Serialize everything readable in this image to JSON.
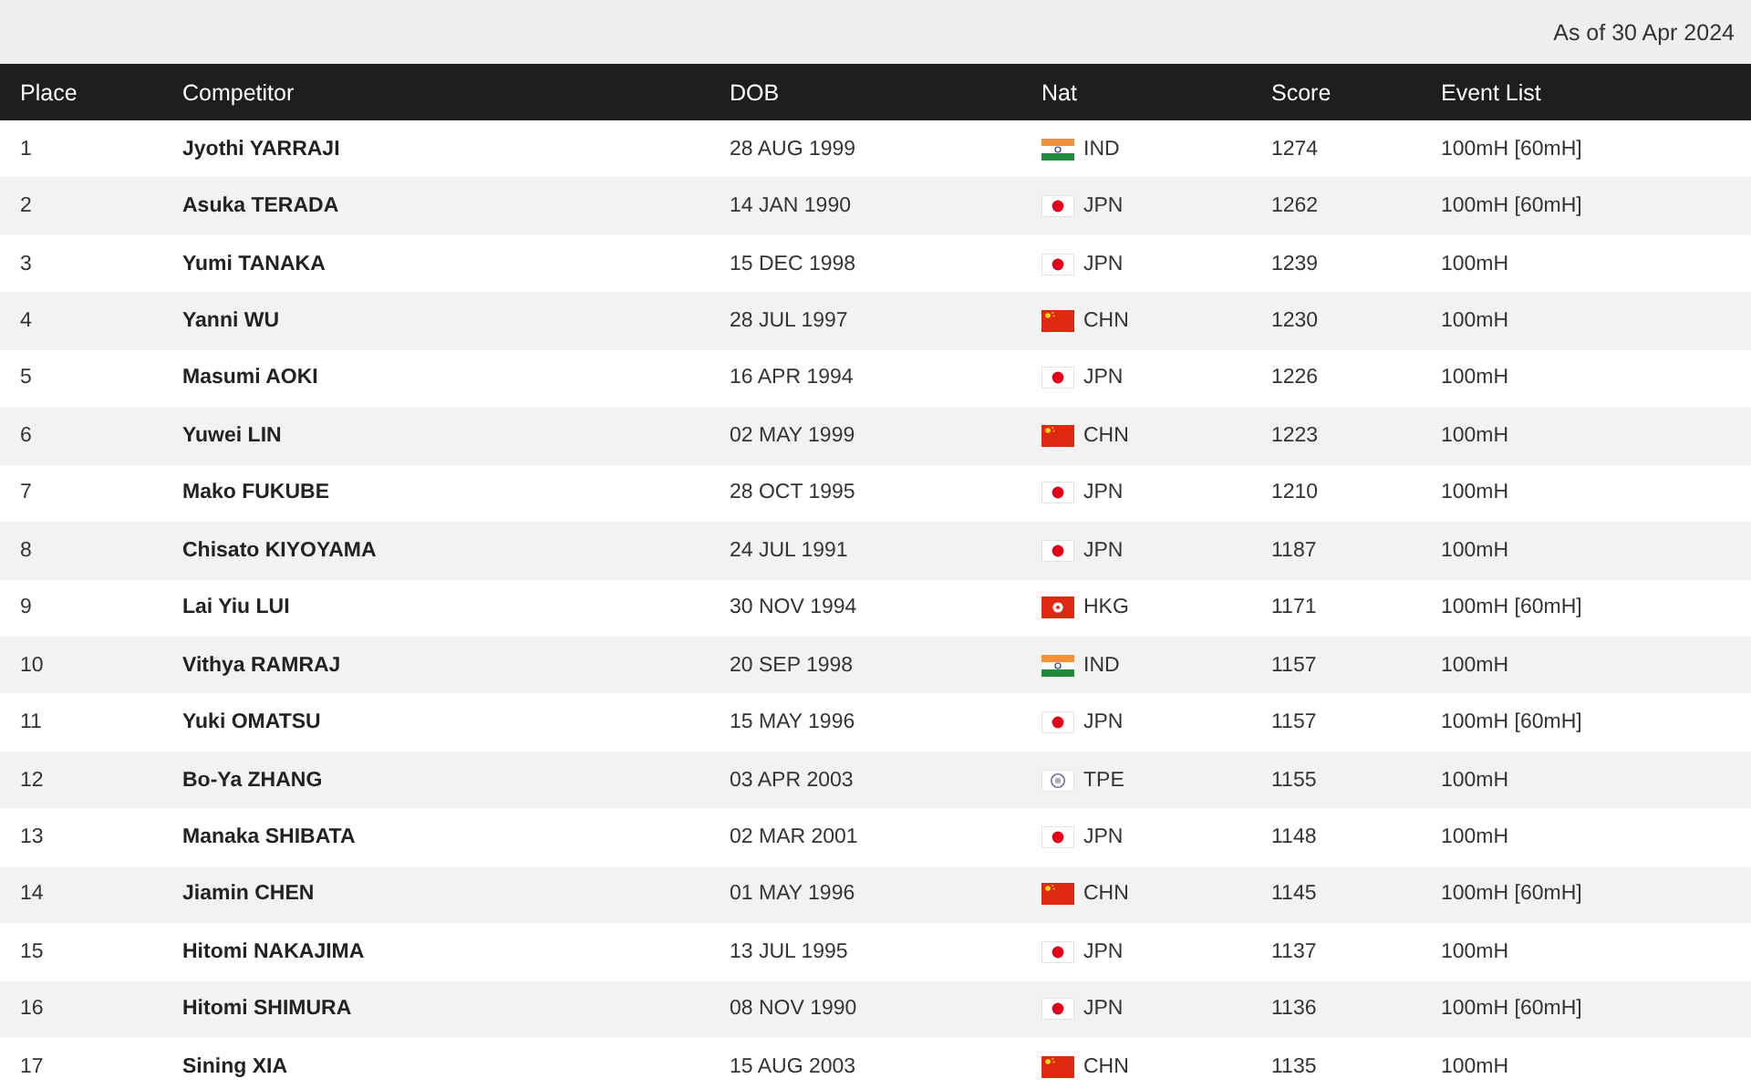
{
  "as_of": "As of 30 Apr 2024",
  "table": {
    "columns": [
      "Place",
      "Competitor",
      "DOB",
      "Nat",
      "Score",
      "Event List"
    ],
    "rows": [
      {
        "place": "1",
        "competitor": "Jyothi YARRAJI",
        "dob": "28 AUG 1999",
        "kind": "tricolor",
        "nat": "IND",
        "score": "1274",
        "events": "100mH [60mH]"
      },
      {
        "place": "2",
        "competitor": "Asuka TERADA",
        "dob": "14 JAN 1990",
        "kind": "disc",
        "nat": "JPN",
        "score": "1262",
        "events": "100mH [60mH]"
      },
      {
        "place": "3",
        "competitor": "Yumi TANAKA",
        "dob": "15 DEC 1998",
        "kind": "disc",
        "nat": "JPN",
        "score": "1239",
        "events": "100mH"
      },
      {
        "place": "4",
        "competitor": "Yanni WU",
        "dob": "28 JUL 1997",
        "kind": "stars",
        "nat": "CHN",
        "score": "1230",
        "events": "100mH"
      },
      {
        "place": "5",
        "competitor": "Masumi AOKI",
        "dob": "16 APR 1994",
        "kind": "disc",
        "nat": "JPN",
        "score": "1226",
        "events": "100mH"
      },
      {
        "place": "6",
        "competitor": "Yuwei LIN",
        "dob": "02 MAY 1999",
        "kind": "stars",
        "nat": "CHN",
        "score": "1223",
        "events": "100mH"
      },
      {
        "place": "7",
        "competitor": "Mako FUKUBE",
        "dob": "28 OCT 1995",
        "kind": "disc",
        "nat": "JPN",
        "score": "1210",
        "events": "100mH"
      },
      {
        "place": "8",
        "competitor": "Chisato KIYOYAMA",
        "dob": "24 JUL 1991",
        "kind": "disc",
        "nat": "JPN",
        "score": "1187",
        "events": "100mH"
      },
      {
        "place": "9",
        "competitor": "Lai Yiu LUI",
        "dob": "30 NOV 1994",
        "kind": "flower",
        "nat": "HKG",
        "score": "1171",
        "events": "100mH [60mH]"
      },
      {
        "place": "10",
        "competitor": "Vithya RAMRAJ",
        "dob": "20 SEP 1998",
        "kind": "tricolor",
        "nat": "IND",
        "score": "1157",
        "events": "100mH"
      },
      {
        "place": "11",
        "competitor": "Yuki OMATSU",
        "dob": "15 MAY 1996",
        "kind": "disc",
        "nat": "JPN",
        "score": "1157",
        "events": "100mH [60mH]"
      },
      {
        "place": "12",
        "competitor": "Bo-Ya ZHANG",
        "dob": "03 APR 2003",
        "kind": "emblem",
        "nat": "TPE",
        "score": "1155",
        "events": "100mH"
      },
      {
        "place": "13",
        "competitor": "Manaka SHIBATA",
        "dob": "02 MAR 2001",
        "kind": "disc",
        "nat": "JPN",
        "score": "1148",
        "events": "100mH"
      },
      {
        "place": "14",
        "competitor": "Jiamin CHEN",
        "dob": "01 MAY 1996",
        "kind": "stars",
        "nat": "CHN",
        "score": "1145",
        "events": "100mH [60mH]"
      },
      {
        "place": "15",
        "competitor": "Hitomi NAKAJIMA",
        "dob": "13 JUL 1995",
        "kind": "disc",
        "nat": "JPN",
        "score": "1137",
        "events": "100mH"
      },
      {
        "place": "16",
        "competitor": "Hitomi SHIMURA",
        "dob": "08 NOV 1990",
        "kind": "disc",
        "nat": "JPN",
        "score": "1136",
        "events": "100mH [60mH]"
      },
      {
        "place": "17",
        "competitor": "Sining XIA",
        "dob": "15 AUG 2003",
        "kind": "stars",
        "nat": "CHN",
        "score": "1135",
        "events": "100mH"
      }
    ]
  }
}
